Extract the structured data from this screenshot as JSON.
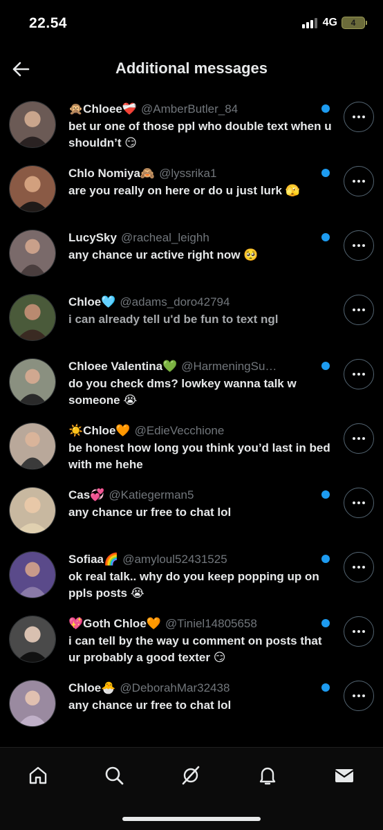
{
  "status": {
    "time": "22.54",
    "network": "4G",
    "battery": "4"
  },
  "header": {
    "title": "Additional messages",
    "back_icon": "arrow-left-icon"
  },
  "messages": [
    {
      "prefix_emoji": "🙊",
      "name": "Chloee",
      "name_emoji": "❤️‍🩹",
      "handle": "@AmberButler_84",
      "text": "bet ur one of those ppl who double text when u shouldn’t 😏",
      "unread": true,
      "avatar_color": "#6b5a55",
      "dim": false
    },
    {
      "prefix_emoji": "",
      "name": "Chlo Nomiya",
      "name_emoji": "🙈",
      "handle": "@lyssrika1",
      "text": "are you really on here or do u just lurk 🫣",
      "unread": true,
      "avatar_color": "#8a5a45",
      "dim": false
    },
    {
      "prefix_emoji": "",
      "name": "LucySky",
      "name_emoji": "",
      "handle": "@racheal_leighh",
      "text": "any chance ur active right now 🥺",
      "unread": true,
      "avatar_color": "#7a6a6a",
      "dim": false
    },
    {
      "prefix_emoji": "",
      "name": "Chloe",
      "name_emoji": "🩵",
      "handle": "@adams_doro42794",
      "text": "i can already tell u'd be fun to text ngl",
      "unread": false,
      "avatar_color": "#4a5a3a",
      "dim": true
    },
    {
      "prefix_emoji": "",
      "name": "Chloee Valentina",
      "name_emoji": "💚",
      "handle": "@HarmeningSu…",
      "text": "do you check dms? lowkey wanna talk w someone 😭",
      "unread": true,
      "avatar_color": "#8a9080",
      "dim": false
    },
    {
      "prefix_emoji": "☀️",
      "name": "Chloe",
      "name_emoji": "🧡",
      "handle": "@EdieVecchione",
      "text": "be honest how long you think you’d last in bed with me hehe",
      "unread": false,
      "avatar_color": "#b9a89a",
      "dim": false
    },
    {
      "prefix_emoji": "",
      "name": "Cas",
      "name_emoji": "💞",
      "handle": "@Katiegerman5",
      "text": "any chance ur free to chat lol",
      "unread": true,
      "avatar_color": "#c8b8a0",
      "dim": false
    },
    {
      "prefix_emoji": "",
      "name": "Sofiaa",
      "name_emoji": "🌈",
      "handle": "@amyloul52431525",
      "text": "ok real talk.. why do you keep popping up on ppls posts 😭",
      "unread": true,
      "avatar_color": "#5a4a8a",
      "dim": false
    },
    {
      "prefix_emoji": "💖",
      "name": "Goth Chloe",
      "name_emoji": "🧡",
      "handle": "@Tiniel14805658",
      "text": "i can tell by the way u comment on posts that ur probably a good texter 😏",
      "unread": true,
      "avatar_color": "#4a4a4a",
      "dim": false
    },
    {
      "prefix_emoji": "",
      "name": "Chloe",
      "name_emoji": "🐣",
      "handle": "@DeborahMar32438",
      "text": "any chance ur free to chat lol",
      "unread": true,
      "avatar_color": "#9a8aa0",
      "dim": false
    }
  ],
  "more_icon": "more-horizontal-icon",
  "tabs": [
    {
      "name": "home",
      "icon": "home-icon"
    },
    {
      "name": "search",
      "icon": "search-icon"
    },
    {
      "name": "grok",
      "icon": "grok-icon"
    },
    {
      "name": "notifications",
      "icon": "bell-icon"
    },
    {
      "name": "messages",
      "icon": "mail-icon"
    }
  ],
  "colors": {
    "accent": "#1d9bf0",
    "background": "#000000",
    "muted": "#71767b"
  }
}
